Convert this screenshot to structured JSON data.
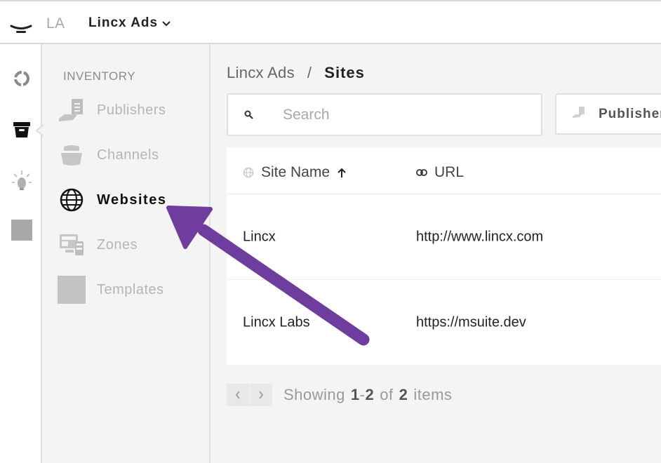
{
  "topbar": {
    "menu_icon": "hamburger-menu-icon",
    "org_abbreviation": "LA",
    "org_name": "Lincx Ads",
    "org_dropdown_icon": "chevron-down-icon"
  },
  "rail": {
    "items": [
      {
        "icon": "ring-icon",
        "active": false
      },
      {
        "icon": "inventory-box-icon",
        "active": true
      },
      {
        "icon": "lightbulb-icon",
        "active": false
      },
      {
        "icon": "placeholder-square-icon",
        "active": false
      }
    ]
  },
  "sidebar": {
    "section_title": "INVENTORY",
    "items": [
      {
        "label": "Publishers",
        "icon": "publisher-hand-icon",
        "active": false
      },
      {
        "label": "Channels",
        "icon": "channels-stack-icon",
        "active": false
      },
      {
        "label": "Websites",
        "icon": "globe-icon",
        "active": true
      },
      {
        "label": "Zones",
        "icon": "zones-layout-icon",
        "active": false
      },
      {
        "label": "Templates",
        "icon": "template-placeholder-icon",
        "active": false
      }
    ]
  },
  "main": {
    "breadcrumb": {
      "root": "Lincx Ads",
      "separator": "/",
      "current": "Sites"
    },
    "search": {
      "placeholder": "Search",
      "icon": "search-icon"
    },
    "filter_button": {
      "label": "Publishers",
      "icon": "publisher-hand-icon"
    },
    "table": {
      "columns": [
        {
          "label": "Site Name",
          "icon": "globe-icon",
          "sort": "ascending"
        },
        {
          "label": "URL",
          "icon": "link-icon"
        }
      ],
      "rows": [
        {
          "site_name": "Lincx",
          "url": "http://www.lincx.com"
        },
        {
          "site_name": "Lincx Labs",
          "url": "https://msuite.dev"
        }
      ]
    },
    "pagination": {
      "prefix": "Showing",
      "range_start": "1",
      "range_sep": "-",
      "range_end": "2",
      "of": "of",
      "total": "2",
      "suffix": "items"
    }
  },
  "annotation": {
    "type": "arrow",
    "color": "#6f3d9e",
    "points_to": "Websites"
  }
}
